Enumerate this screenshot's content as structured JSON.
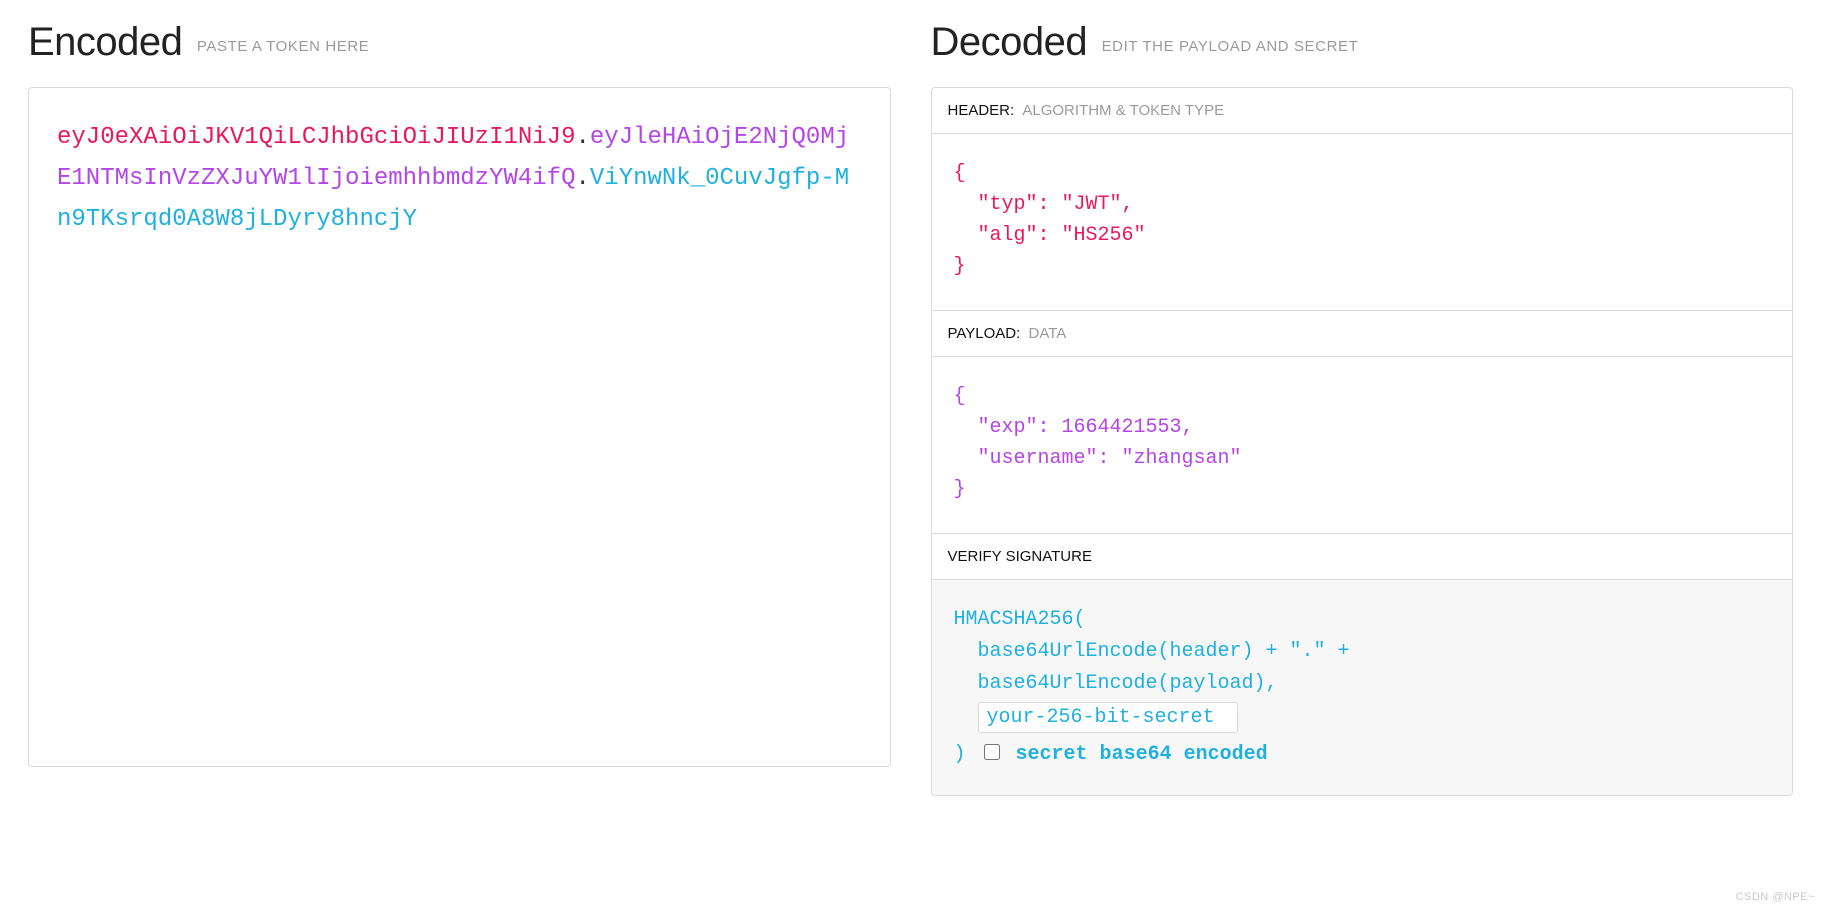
{
  "encoded": {
    "title": "Encoded",
    "subtitle": "PASTE A TOKEN HERE",
    "token": {
      "header": "eyJ0eXAiOiJKV1QiLCJhbGciOiJIUzI1NiJ9",
      "payload": "eyJleHAiOjE2NjQ0MjE1NTMsInVzZXJuYW1lIjoiemhhbmdzYW4ifQ",
      "signature": "ViYnwNk_0CuvJgfp-Mn9TKsrqd0A8W8jLDyry8hncjY"
    }
  },
  "decoded": {
    "title": "Decoded",
    "subtitle": "EDIT THE PAYLOAD AND SECRET",
    "headerSection": {
      "label": "HEADER:",
      "sublabel": "ALGORITHM & TOKEN TYPE",
      "json": "{\n  \"typ\": \"JWT\",\n  \"alg\": \"HS256\"\n}"
    },
    "payloadSection": {
      "label": "PAYLOAD:",
      "sublabel": "DATA",
      "json": "{\n  \"exp\": 1664421553,\n  \"username\": \"zhangsan\"\n}"
    },
    "signatureSection": {
      "label": "VERIFY SIGNATURE",
      "line1": "HMACSHA256(",
      "line2": "base64UrlEncode(header) + \".\" +",
      "line3": "base64UrlEncode(payload),",
      "secretValue": "your-256-bit-secret",
      "closingParen": ")",
      "checkboxLabel": "secret base64 encoded"
    }
  },
  "watermark": "CSDN @NPE~"
}
